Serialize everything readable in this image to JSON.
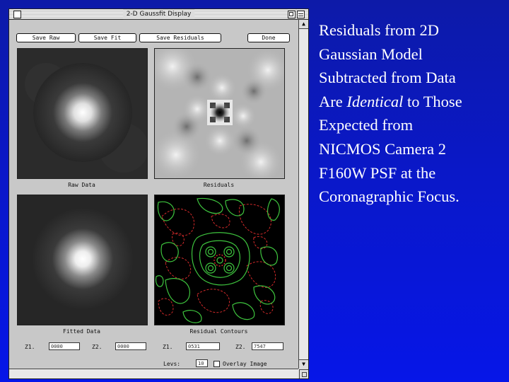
{
  "window": {
    "title": "2-D Gaussfit Display"
  },
  "toolbar": {
    "save_raw": "Save Raw",
    "save_fit": "Save Fit",
    "save_residuals": "Save Residuals",
    "done": "Done"
  },
  "panels": {
    "raw_data": "Raw Data",
    "residuals": "Residuals",
    "fitted_data": "Fitted Data",
    "residual_contours": "Residual Contours"
  },
  "fields": {
    "fit_z1_label": "Z1.",
    "fit_z1_value": "0000",
    "fit_z2_label": "Z2.",
    "fit_z2_value": "0000",
    "res_z1_label": "Z1.",
    "res_z1_value": "0531",
    "res_z2_label": "Z2.",
    "res_z2_value": "7547",
    "levs_label": "Levs:",
    "levs_value": "10",
    "overlay_label": "Overlay Image"
  },
  "slide_text": {
    "line1": "Residuals from 2D",
    "line2": "Gaussian Model",
    "line3": "Subtracted from Data",
    "line4_pre": "Are ",
    "line4_em": "Identical",
    "line4_post": " to Those",
    "line5": "Expected from",
    "line6": "NICMOS Camera 2",
    "line7": "F160W PSF at the",
    "line8": "Coronagraphic Focus."
  },
  "colors": {
    "background": "#0a18c8",
    "contour_positive": "#3ec43e",
    "contour_negative": "#d22a2a"
  }
}
